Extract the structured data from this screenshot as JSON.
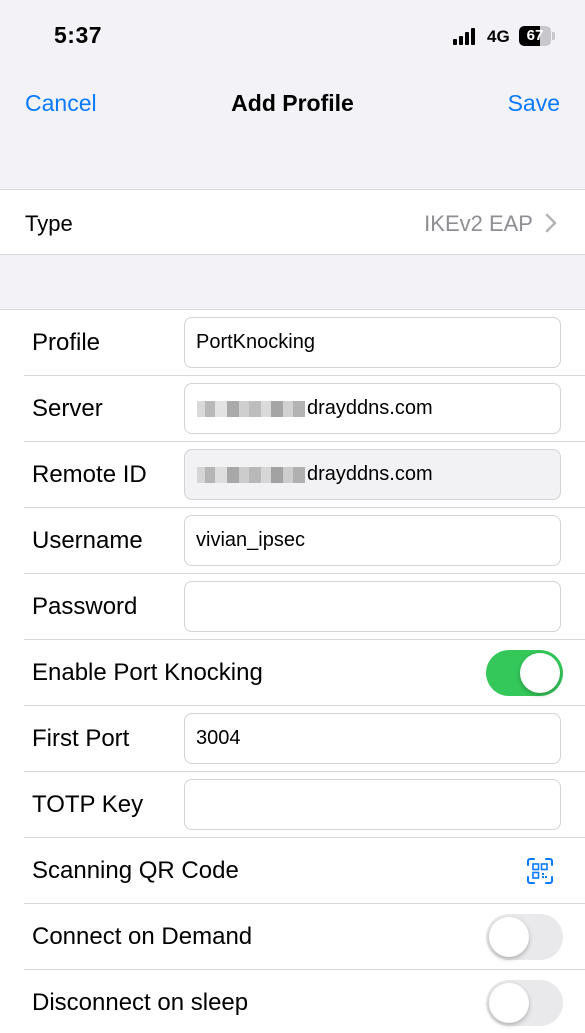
{
  "status_bar": {
    "time": "5:37",
    "network": "4G",
    "battery": "67"
  },
  "nav": {
    "cancel": "Cancel",
    "title": "Add Profile",
    "save": "Save"
  },
  "type_row": {
    "label": "Type",
    "value": "IKEv2 EAP"
  },
  "form": {
    "profile": {
      "label": "Profile",
      "value": "PortKnocking"
    },
    "server": {
      "label": "Server",
      "value_suffix": "drayddns.com"
    },
    "remote_id": {
      "label": "Remote ID",
      "value_suffix": "drayddns.com"
    },
    "username": {
      "label": "Username",
      "value": "vivian_ipsec"
    },
    "password": {
      "label": "Password",
      "value": ""
    },
    "enable_port_knocking": {
      "label": "Enable Port Knocking",
      "enabled": true
    },
    "first_port": {
      "label": "First Port",
      "value": "3004"
    },
    "totp_key": {
      "label": "TOTP Key",
      "value": ""
    },
    "scan_qr": {
      "label": "Scanning QR Code",
      "icon": "qr-code-scan-icon"
    },
    "connect_on_demand": {
      "label": "Connect on Demand",
      "enabled": false
    },
    "disconnect_on_sleep": {
      "label": "Disconnect on sleep",
      "enabled": false
    }
  },
  "colors": {
    "accent": "#0a7aff",
    "toggle_on": "#34c759",
    "toggle_off": "#e9e9eb",
    "background": "#f2f2f7"
  }
}
